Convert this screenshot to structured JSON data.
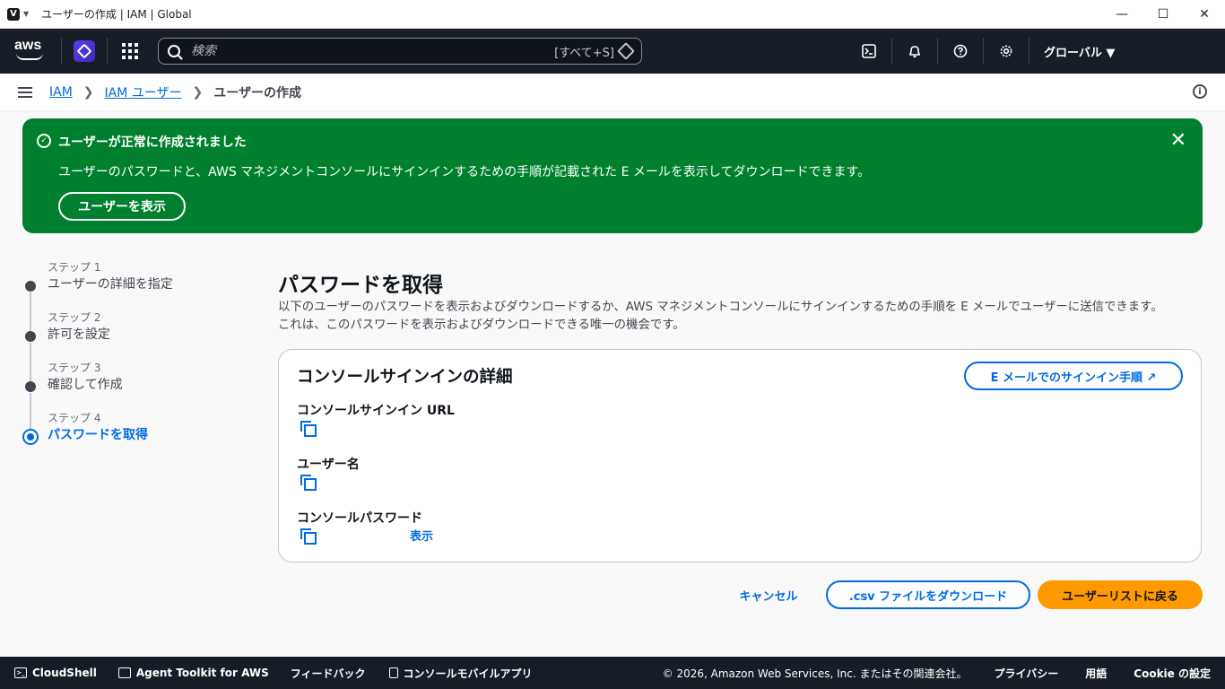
{
  "browser": {
    "title": "ユーザーの作成 | IAM | Global",
    "logo": "V"
  },
  "topnav": {
    "brand": "aws",
    "search_placeholder": "検索",
    "search_shortcut": "[すべて+S]",
    "region": "グローバル ▼"
  },
  "breadcrumb": {
    "items": [
      "IAM",
      "IAM ユーザー"
    ],
    "current": "ユーザーの作成"
  },
  "flash": {
    "title": "ユーザーが正常に作成されました",
    "body": "ユーザーのパスワードと、AWS マネジメントコンソールにサインインするための手順が記載された E メールを表示してダウンロードできます。",
    "button": "ユーザーを表示",
    "color": "#00802f"
  },
  "steps": [
    {
      "num": "ステップ 1",
      "label": "ユーザーの詳細を指定"
    },
    {
      "num": "ステップ 2",
      "label": "許可を設定"
    },
    {
      "num": "ステップ 3",
      "label": "確認して作成"
    },
    {
      "num": "ステップ 4",
      "label": "パスワードを取得"
    }
  ],
  "main": {
    "title": "パスワードを取得",
    "desc_line1": "以下のユーザーのパスワードを表示およびダウンロードするか、AWS マネジメントコンソールにサインインするための手順を E メールでユーザーに送信できます。",
    "desc_line2": "これは、このパスワードを表示およびダウンロードできる唯一の機会です。"
  },
  "card": {
    "title": "コンソールサインインの詳細",
    "email_button": "E メールでのサインイン手順 ↗",
    "url_label": "コンソールサインイン URL",
    "username_label": "ユーザー名",
    "password_label": "コンソールパスワード",
    "show_link": "表示"
  },
  "actions": {
    "cancel": "キャンセル",
    "csv": ".csv ファイルをダウンロード",
    "primary": "ユーザーリストに戻る",
    "primary_color": "#ff9900"
  },
  "footer": {
    "cloudshell": "CloudShell",
    "agent_toolkit": "Agent Toolkit for AWS",
    "feedback": "フィードバック",
    "mobile_app": "コンソールモバイルアプリ",
    "copyright": "© 2026, Amazon Web Services, Inc. またはその関連会社。",
    "privacy": "プライバシー",
    "terms": "用語",
    "cookie": "Cookie の設定"
  }
}
